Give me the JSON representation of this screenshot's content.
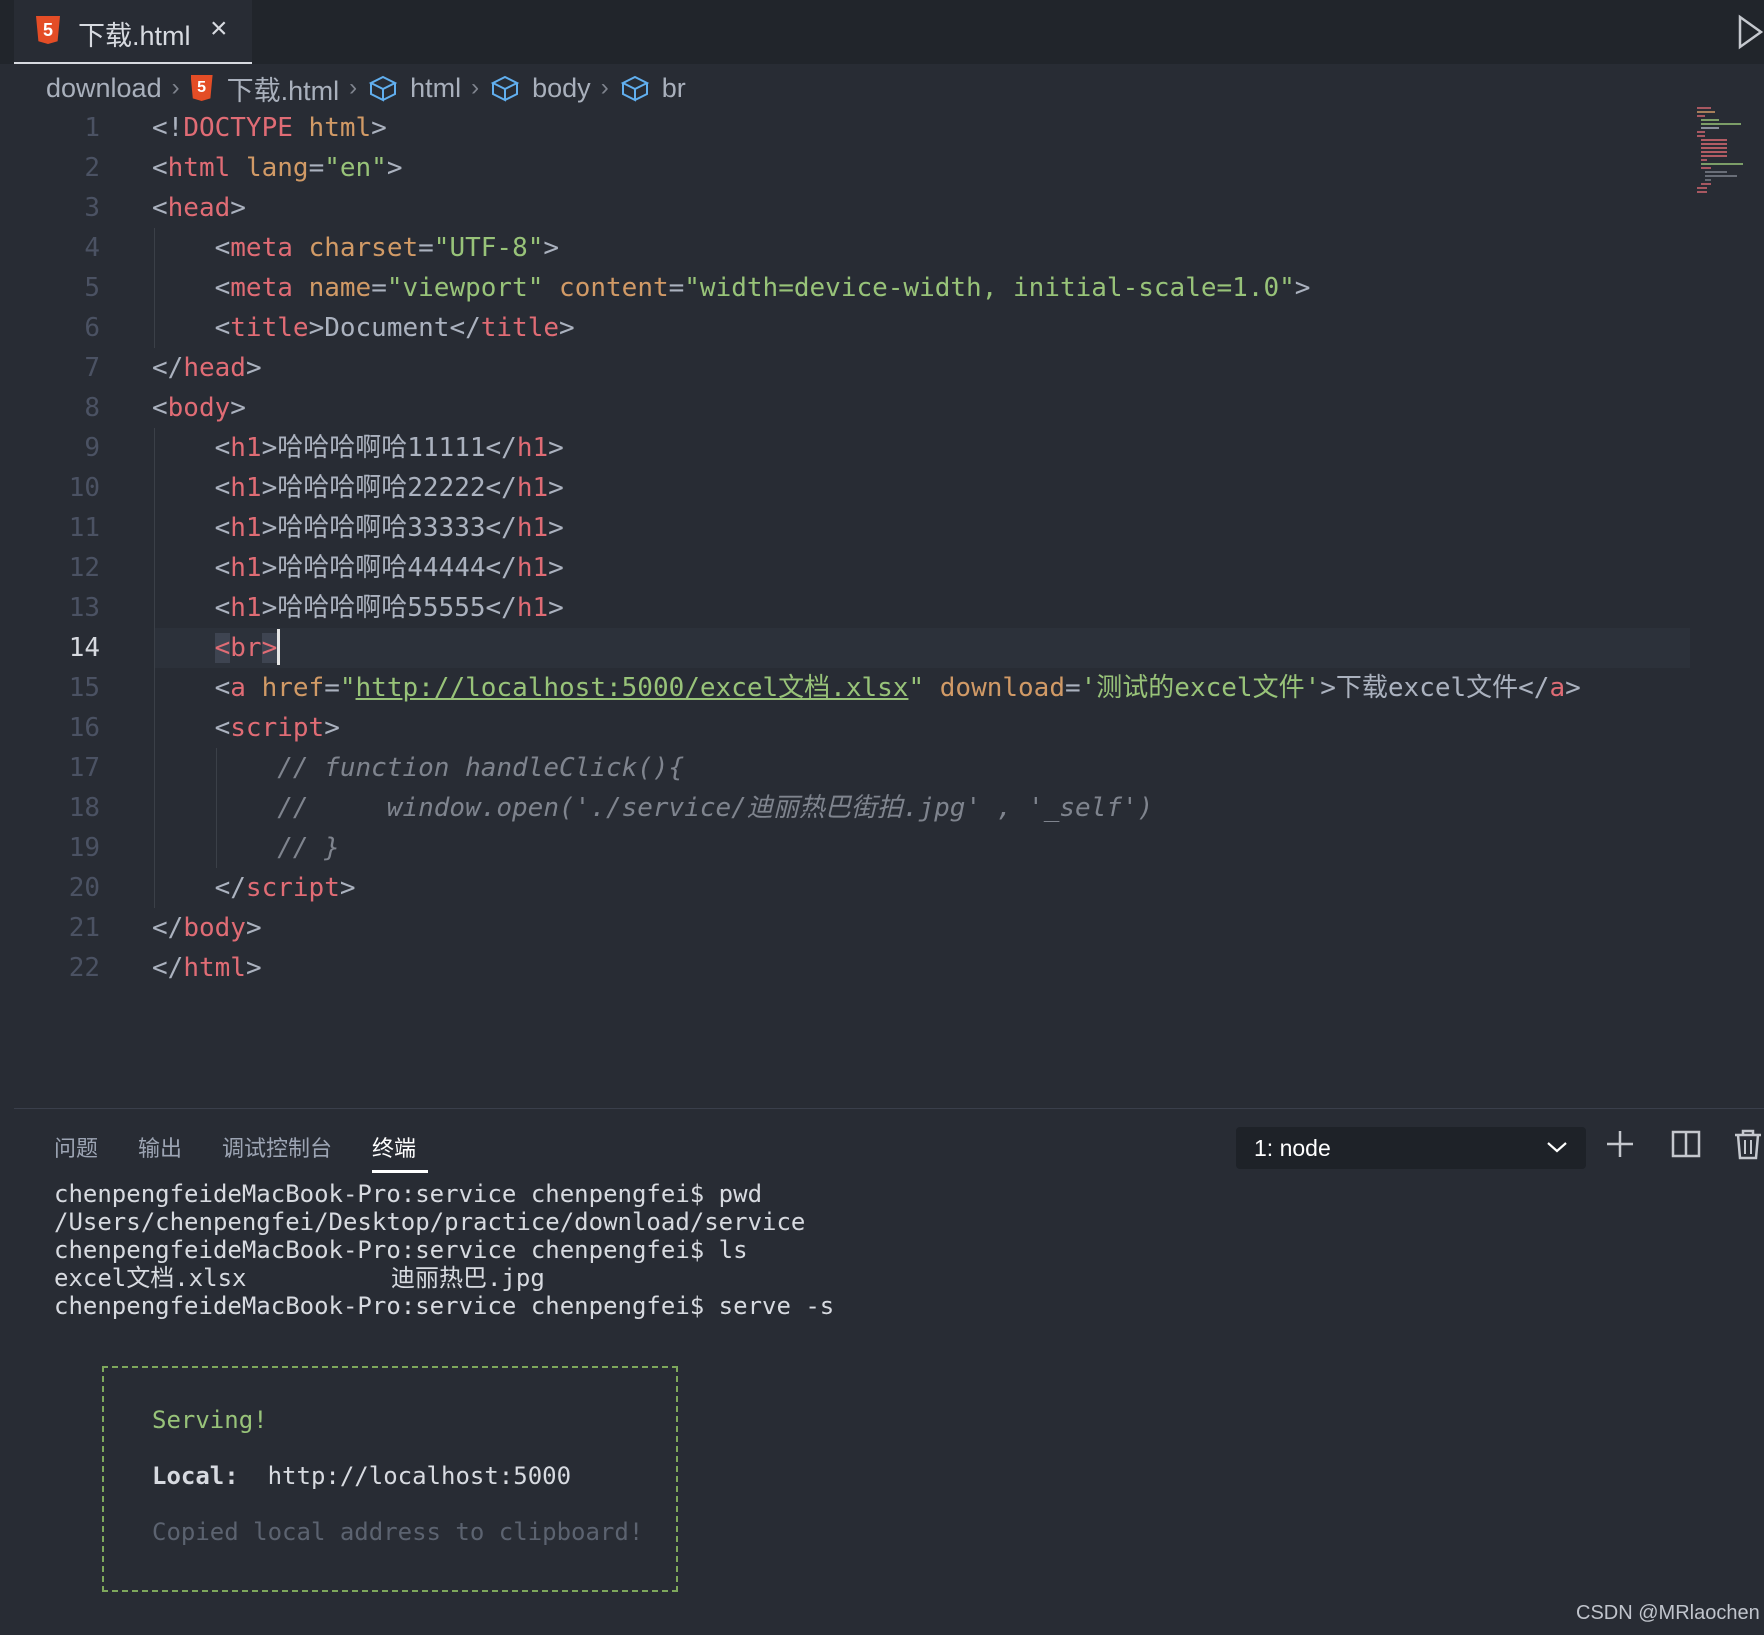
{
  "tab": {
    "icon": "html5-icon",
    "badge": "5",
    "title": "下载.html",
    "close": "×"
  },
  "breadcrumb": [
    "download",
    "下载.html",
    "html",
    "body",
    "br"
  ],
  "editor": {
    "active_line": 14,
    "lines": [
      {
        "n": "1",
        "parts": [
          [
            "p",
            "<!"
          ],
          [
            "t",
            "DOCTYPE"
          ],
          [
            "p",
            " "
          ],
          [
            "a",
            "html"
          ],
          [
            "p",
            ">"
          ]
        ]
      },
      {
        "n": "2",
        "parts": [
          [
            "p",
            "<"
          ],
          [
            "t",
            "html"
          ],
          [
            "p",
            " "
          ],
          [
            "a",
            "lang"
          ],
          [
            "p",
            "="
          ],
          [
            "s",
            "\"en\""
          ],
          [
            "p",
            ">"
          ]
        ]
      },
      {
        "n": "3",
        "parts": [
          [
            "p",
            "<"
          ],
          [
            "t",
            "head"
          ],
          [
            "p",
            ">"
          ]
        ]
      },
      {
        "n": "4",
        "parts": [
          [
            "p",
            "    <"
          ],
          [
            "t",
            "meta"
          ],
          [
            "p",
            " "
          ],
          [
            "a",
            "charset"
          ],
          [
            "p",
            "="
          ],
          [
            "s",
            "\"UTF-8\""
          ],
          [
            "p",
            ">"
          ]
        ]
      },
      {
        "n": "5",
        "parts": [
          [
            "p",
            "    <"
          ],
          [
            "t",
            "meta"
          ],
          [
            "p",
            " "
          ],
          [
            "a",
            "name"
          ],
          [
            "p",
            "="
          ],
          [
            "s",
            "\"viewport\""
          ],
          [
            "p",
            " "
          ],
          [
            "a",
            "content"
          ],
          [
            "p",
            "="
          ],
          [
            "s",
            "\"width=device-width, initial-scale=1.0\""
          ],
          [
            "p",
            ">"
          ]
        ]
      },
      {
        "n": "6",
        "parts": [
          [
            "p",
            "    <"
          ],
          [
            "t",
            "title"
          ],
          [
            "p",
            ">Document</"
          ],
          [
            "t",
            "title"
          ],
          [
            "p",
            ">"
          ]
        ]
      },
      {
        "n": "7",
        "parts": [
          [
            "p",
            "</"
          ],
          [
            "t",
            "head"
          ],
          [
            "p",
            ">"
          ]
        ]
      },
      {
        "n": "8",
        "parts": [
          [
            "p",
            "<"
          ],
          [
            "t",
            "body"
          ],
          [
            "p",
            ">"
          ]
        ]
      },
      {
        "n": "9",
        "parts": [
          [
            "p",
            "    <"
          ],
          [
            "t",
            "h1"
          ],
          [
            "p",
            ">哈哈哈啊哈11111</"
          ],
          [
            "t",
            "h1"
          ],
          [
            "p",
            ">"
          ]
        ]
      },
      {
        "n": "10",
        "parts": [
          [
            "p",
            "    <"
          ],
          [
            "t",
            "h1"
          ],
          [
            "p",
            ">哈哈哈啊哈22222</"
          ],
          [
            "t",
            "h1"
          ],
          [
            "p",
            ">"
          ]
        ]
      },
      {
        "n": "11",
        "parts": [
          [
            "p",
            "    <"
          ],
          [
            "t",
            "h1"
          ],
          [
            "p",
            ">哈哈哈啊哈33333</"
          ],
          [
            "t",
            "h1"
          ],
          [
            "p",
            ">"
          ]
        ]
      },
      {
        "n": "12",
        "parts": [
          [
            "p",
            "    <"
          ],
          [
            "t",
            "h1"
          ],
          [
            "p",
            ">哈哈哈啊哈44444</"
          ],
          [
            "t",
            "h1"
          ],
          [
            "p",
            ">"
          ]
        ]
      },
      {
        "n": "13",
        "parts": [
          [
            "p",
            "    <"
          ],
          [
            "t",
            "h1"
          ],
          [
            "p",
            ">哈哈哈啊哈55555</"
          ],
          [
            "t",
            "h1"
          ],
          [
            "p",
            ">"
          ]
        ]
      },
      {
        "n": "14",
        "parts": [
          [
            "p",
            "    "
          ],
          [
            "bm",
            "<"
          ],
          [
            "t",
            "br"
          ],
          [
            "bm",
            ">"
          ],
          [
            "cur",
            ""
          ]
        ]
      },
      {
        "n": "15",
        "parts": [
          [
            "p",
            "    <"
          ],
          [
            "t",
            "a"
          ],
          [
            "p",
            " "
          ],
          [
            "a",
            "href"
          ],
          [
            "p",
            "="
          ],
          [
            "s",
            "\""
          ],
          [
            "su",
            "http://localhost:5000/excel文档.xlsx"
          ],
          [
            "s",
            "\""
          ],
          [
            "p",
            " "
          ],
          [
            "a",
            "download"
          ],
          [
            "p",
            "="
          ],
          [
            "s",
            "'测试的excel文件'"
          ],
          [
            "p",
            ">下载excel文件</"
          ],
          [
            "t",
            "a"
          ],
          [
            "p",
            ">"
          ]
        ]
      },
      {
        "n": "16",
        "parts": [
          [
            "p",
            "    <"
          ],
          [
            "t",
            "script"
          ],
          [
            "p",
            ">"
          ]
        ]
      },
      {
        "n": "17",
        "parts": [
          [
            "c",
            "        // function handleClick(){"
          ]
        ]
      },
      {
        "n": "18",
        "parts": [
          [
            "c",
            "        //     window.open('./service/迪丽热巴街拍.jpg' , '_self')"
          ]
        ]
      },
      {
        "n": "19",
        "parts": [
          [
            "c",
            "        // }"
          ]
        ]
      },
      {
        "n": "20",
        "parts": [
          [
            "p",
            "    </"
          ],
          [
            "t",
            "script"
          ],
          [
            "p",
            ">"
          ]
        ]
      },
      {
        "n": "21",
        "parts": [
          [
            "p",
            "</"
          ],
          [
            "t",
            "body"
          ],
          [
            "p",
            ">"
          ]
        ]
      },
      {
        "n": "22",
        "parts": [
          [
            "p",
            "</"
          ],
          [
            "t",
            "html"
          ],
          [
            "p",
            ">"
          ]
        ]
      }
    ]
  },
  "panel": {
    "tabs": [
      "问题",
      "输出",
      "调试控制台",
      "终端"
    ],
    "selected_tab": "终端",
    "terminal_select": "1: node",
    "icons": [
      "plus-icon",
      "split-terminal-icon",
      "trash-icon"
    ]
  },
  "terminal": {
    "lines": [
      "chenpengfeideMacBook-Pro:service chenpengfei$ pwd",
      "/Users/chenpengfei/Desktop/practice/download/service",
      "chenpengfeideMacBook-Pro:service chenpengfei$ ls",
      "excel文档.xlsx          迪丽热巴.jpg",
      "chenpengfeideMacBook-Pro:service chenpengfei$ serve -s"
    ],
    "serving": "Serving!",
    "local_label": "Local:",
    "local_url": "http://localhost:5000",
    "copied": "Copied local address to clipboard!"
  },
  "colors": {
    "background": "#282c34",
    "tag": "#e06c75",
    "attribute": "#d19a66",
    "string": "#98c379",
    "comment": "#7f848e",
    "serving": "#98c379",
    "box_border": "#7ea85c"
  },
  "watermark": "CSDN @MRlaochen"
}
